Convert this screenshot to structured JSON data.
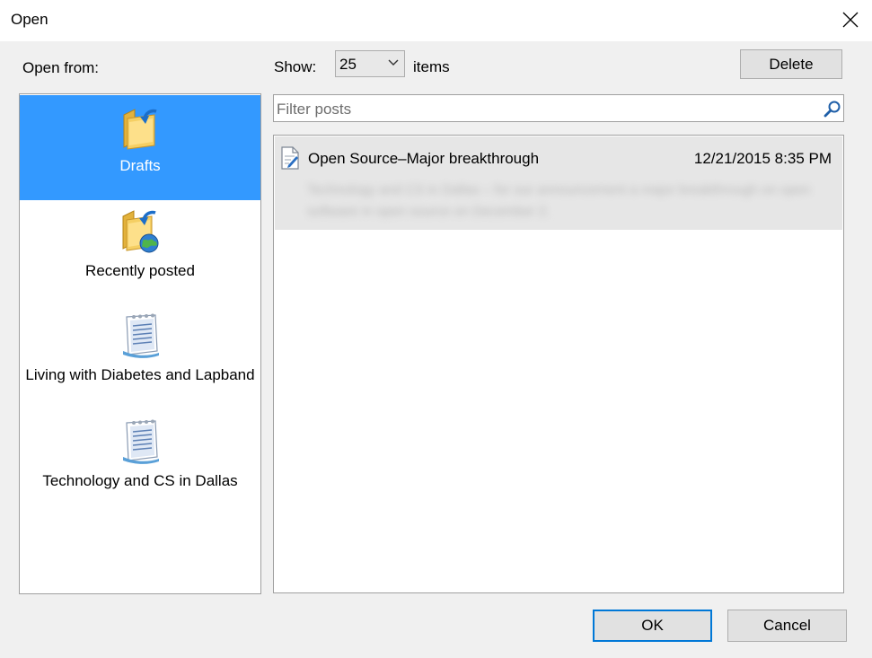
{
  "window": {
    "title": "Open"
  },
  "sidebar": {
    "heading": "Open from:",
    "items": [
      {
        "label": "Drafts",
        "icon": "drafts-folder-icon",
        "selected": true
      },
      {
        "label": "Recently posted",
        "icon": "recently-posted-folder-icon",
        "selected": false
      },
      {
        "label": "Living with Diabetes and Lapband",
        "icon": "blog-notebook-icon",
        "selected": false
      },
      {
        "label": "Technology and CS in Dallas",
        "icon": "blog-notebook-icon",
        "selected": false
      }
    ]
  },
  "toolbar": {
    "show_label": "Show:",
    "show_value": "25",
    "items_label": "items",
    "delete_label": "Delete"
  },
  "filter": {
    "placeholder": "Filter posts"
  },
  "posts": [
    {
      "title": "Open Source–Major breakthrough",
      "date": "12/21/2015 8:35 PM",
      "excerpt": "Technology and CS in Dallas – for our announcement a major breakthrough on open software in open source on December 2."
    }
  ],
  "footer": {
    "ok_label": "OK",
    "cancel_label": "Cancel"
  },
  "colors": {
    "selection": "#3399ff",
    "accent": "#0078d7",
    "row": "#e6e6e6"
  }
}
